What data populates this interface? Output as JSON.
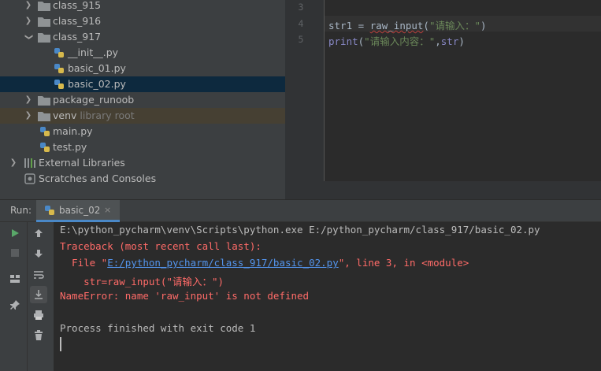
{
  "project_tree": {
    "items": [
      {
        "label": "class_915",
        "hint": "",
        "kind": "folder",
        "expanded": false
      },
      {
        "label": "class_916",
        "hint": "",
        "kind": "folder",
        "expanded": false
      },
      {
        "label": "class_917",
        "hint": "",
        "kind": "folder",
        "expanded": true
      },
      {
        "label": "__init__.py",
        "hint": "",
        "kind": "python-file"
      },
      {
        "label": "basic_01.py",
        "hint": "",
        "kind": "python-file"
      },
      {
        "label": "basic_02.py",
        "hint": "",
        "kind": "python-file",
        "selected": true
      },
      {
        "label": "package_runoob",
        "hint": "",
        "kind": "folder",
        "expanded": false
      },
      {
        "label": "venv",
        "hint": "library root",
        "kind": "folder",
        "expanded": false
      },
      {
        "label": "main.py",
        "hint": "",
        "kind": "python-file"
      },
      {
        "label": "test.py",
        "hint": "",
        "kind": "python-file"
      },
      {
        "label": "External Libraries",
        "hint": "",
        "kind": "libraries",
        "expanded": false
      },
      {
        "label": "Scratches and Consoles",
        "hint": "",
        "kind": "scratches"
      }
    ]
  },
  "editor": {
    "line_numbers": [
      "3",
      "4",
      "5"
    ],
    "line4": {
      "var": "str1",
      "op": " = ",
      "func": "raw_input",
      "open": "(",
      "str": "\"请输入：\"",
      "close": ")"
    },
    "line5": {
      "func": "print",
      "open": "(",
      "str": "\"请输入内容：\"",
      "comma": ",",
      "arg": "str",
      "close": ")"
    }
  },
  "run_panel": {
    "label": "Run:",
    "tab_label": "basic_02",
    "tab_close": "×"
  },
  "console": {
    "command": "E:\\python_pycharm\\venv\\Scripts\\python.exe E:/python_pycharm/class_917/basic_02.py",
    "traceback_header": "Traceback (most recent call last):",
    "file_prefix": "  File \"",
    "file_link": "E:/python_pycharm/class_917/basic_02.py",
    "file_suffix": "\", line 3, in <module>",
    "source_line": "    str=raw_input(\"请输入：\")",
    "error": "NameError: name 'raw_input' is not defined",
    "exit_message": "Process finished with exit code 1"
  },
  "colors": {
    "panel_bg": "#3c3f41",
    "editor_bg": "#2b2b2b",
    "selection": "#0d293e",
    "error_text": "#ff6b68",
    "link": "#5394ec",
    "string": "#6a8759",
    "builtin": "#8888c6",
    "accent": "#4a88c7"
  },
  "icons": {
    "folder": "folder-icon",
    "python_file": "python-file-icon",
    "libraries": "libraries-icon",
    "scratches": "scratches-icon",
    "run": "run-icon",
    "stop": "stop-icon",
    "up": "arrow-up-icon",
    "down": "arrow-down-icon",
    "wrap": "soft-wrap-icon",
    "scroll_end": "scroll-to-end-icon",
    "print": "print-icon",
    "trash": "trash-icon",
    "layout": "layout-icon",
    "pin": "pin-icon"
  }
}
